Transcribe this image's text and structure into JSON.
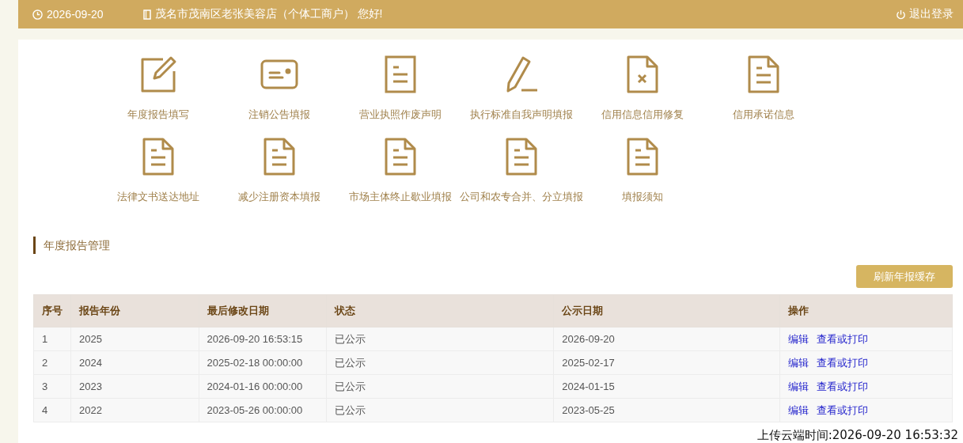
{
  "top_bar": {
    "date": "2026-09-20",
    "greeting": "茂名市茂南区老张美容店（个体工商户） 您好!",
    "logout": "退出登录"
  },
  "services": [
    {
      "label": "年度报告填写",
      "kind": "edit"
    },
    {
      "label": "注销公告填报",
      "kind": "card"
    },
    {
      "label": "营业执照作废声明",
      "kind": "document"
    },
    {
      "label": "执行标准自我声明填报",
      "kind": "pencil"
    },
    {
      "label": "信用信息信用修复",
      "kind": "document-x"
    },
    {
      "label": "信用承诺信息",
      "kind": "document-folded"
    },
    {
      "label": "法律文书送达地址",
      "kind": "document-folded"
    },
    {
      "label": "减少注册资本填报",
      "kind": "document-folded"
    },
    {
      "label": "市场主体终止歇业填报",
      "kind": "document-folded"
    },
    {
      "label": "公司和农专合并、分立填报",
      "kind": "document-folded"
    },
    {
      "label": "填报须知",
      "kind": "document-folded"
    }
  ],
  "section_title": "年度报告管理",
  "refresh_button": "刷新年报缓存",
  "table": {
    "columns": [
      "序号",
      "报告年份",
      "最后修改日期",
      "状态",
      "公示日期",
      "操作"
    ],
    "rows": [
      {
        "cells": [
          "1",
          "2025",
          "2026-09-20 16:53:15",
          "已公示",
          "2026-09-20"
        ],
        "actions": [
          "编辑",
          "查看或打印"
        ]
      },
      {
        "cells": [
          "2",
          "2024",
          "2025-02-18 00:00:00",
          "已公示",
          "2025-02-17"
        ],
        "actions": [
          "编辑",
          "查看或打印"
        ]
      },
      {
        "cells": [
          "3",
          "2023",
          "2024-01-16 00:00:00",
          "已公示",
          "2024-01-15"
        ],
        "actions": [
          "编辑",
          "查看或打印"
        ]
      },
      {
        "cells": [
          "4",
          "2022",
          "2023-05-26 00:00:00",
          "已公示",
          "2023-05-25"
        ],
        "actions": [
          "编辑",
          "查看或打印"
        ]
      }
    ]
  },
  "upload_time": "上传云端时间:2026-09-20 16:53:32"
}
